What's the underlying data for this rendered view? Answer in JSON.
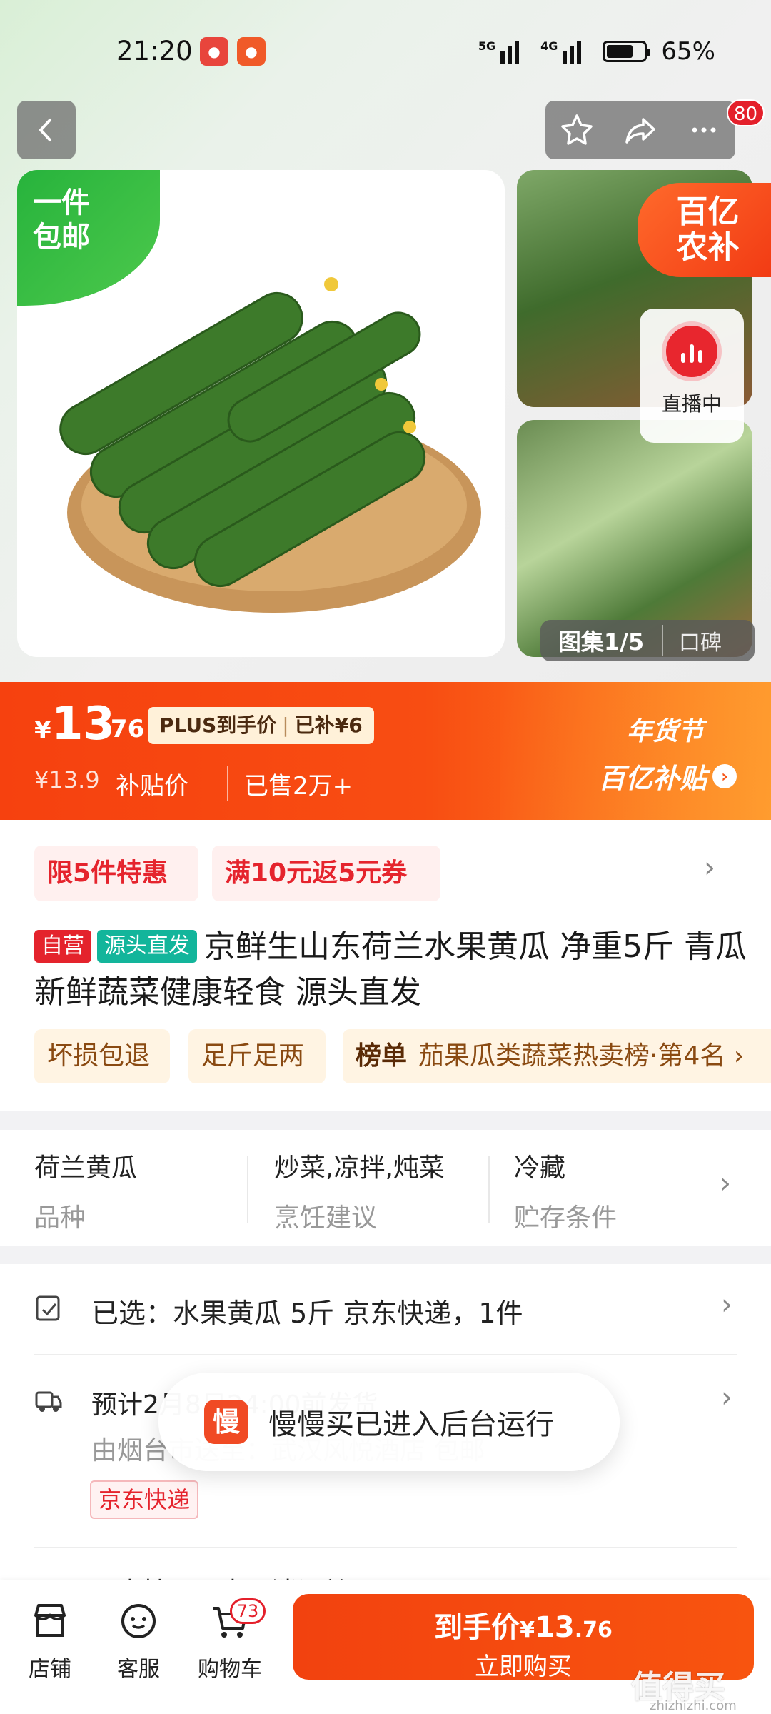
{
  "status": {
    "time": "21:20",
    "net1": "5G",
    "net2": "4G",
    "battery": "65%"
  },
  "header": {
    "badge_count": "80"
  },
  "hero": {
    "free_shipping_line1": "一件",
    "free_shipping_line2": "包邮",
    "subsidy_badge_line1": "百亿",
    "subsidy_badge_line2": "农补",
    "live_label": "直播中",
    "gallery_label": "图集1/5",
    "review_label": "口碑"
  },
  "price": {
    "currency": "¥",
    "integer": "13",
    "decimal": ".76",
    "plus_label": "PLUS到手价",
    "plus_subsidy": "已补¥6",
    "original": "¥13.9",
    "original_label": "补贴价",
    "sold": "已售2万+",
    "festival": "年货节",
    "festival_sub": "百亿补贴"
  },
  "promos": [
    "限5件特惠",
    "满10元返5元券"
  ],
  "product": {
    "tag_self": "自营",
    "tag_source": "源头直发",
    "title": "京鲜生山东荷兰水果黄瓜 净重5斤 青瓜新鲜蔬菜健康轻食 源头直发"
  },
  "features": {
    "f1": "坏损包退",
    "f2": "足斤足两",
    "rank_label": "榜单",
    "rank_text": "茄果瓜类蔬菜热卖榜·第4名"
  },
  "attributes": [
    {
      "value": "荷兰黄瓜",
      "key": "品种"
    },
    {
      "value": "炒菜,凉拌,炖菜",
      "key": "烹饪建议"
    },
    {
      "value": "冷藏",
      "key": "贮存条件"
    }
  ],
  "selection": {
    "selected": "已选：水果黄瓜 5斤 京东快递，1件",
    "shipping_line1": "预计2月8日24:00前发货",
    "shipping_line2": "由烟台市送至：武汉风悦酒店  包邮",
    "express_tag": "京东快递",
    "row4": "不支持无理由取消订单"
  },
  "toast": {
    "icon": "慢",
    "text": "慢慢买已进入后台运行"
  },
  "bottom": {
    "shop": "店铺",
    "service": "客服",
    "cart": "购物车",
    "cart_count": "73",
    "buy_price_label": "到手价",
    "buy_currency": "¥",
    "buy_int": "13",
    "buy_dec": ".76",
    "buy_now": "立即购买"
  },
  "watermark": {
    "text": "值得买",
    "url": "zhizhizhi.com"
  },
  "colors": {
    "accent": "#f6410f",
    "badge_red": "#e4202b",
    "promo_red": "#e5242d",
    "green": "#27b33c",
    "teal": "#13b59b"
  }
}
